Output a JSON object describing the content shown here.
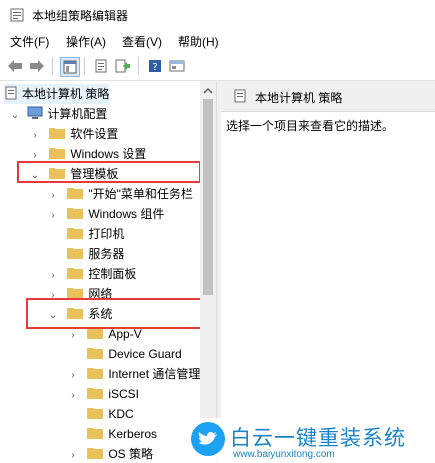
{
  "window": {
    "title": "本地组策略编辑器"
  },
  "menu": [
    "文件(F)",
    "操作(A)",
    "查看(V)",
    "帮助(H)"
  ],
  "tree": {
    "root": "本地计算机 策略",
    "computer_config": "计算机配置",
    "software_settings": "软件设置",
    "windows_settings": "Windows 设置",
    "admin_templates": "管理模板",
    "admin_children": [
      "\"开始\"菜单和任务栏",
      "Windows 组件",
      "打印机",
      "服务器",
      "控制面板",
      "网络"
    ],
    "system": "系统",
    "system_children": [
      "App-V",
      "Device Guard",
      "Internet 通信管理",
      "iSCSI",
      "KDC",
      "Kerberos",
      "OS 策略"
    ]
  },
  "right": {
    "header": "本地计算机 策略",
    "description": "选择一个项目来查看它的描述。"
  },
  "watermark": {
    "brand": "白云一键重装系统",
    "url": "www.baiyunxitong.com"
  },
  "colors": {
    "highlight": "#e83a3a",
    "folder": "#e8c15a",
    "twitter": "#1da1f2"
  }
}
